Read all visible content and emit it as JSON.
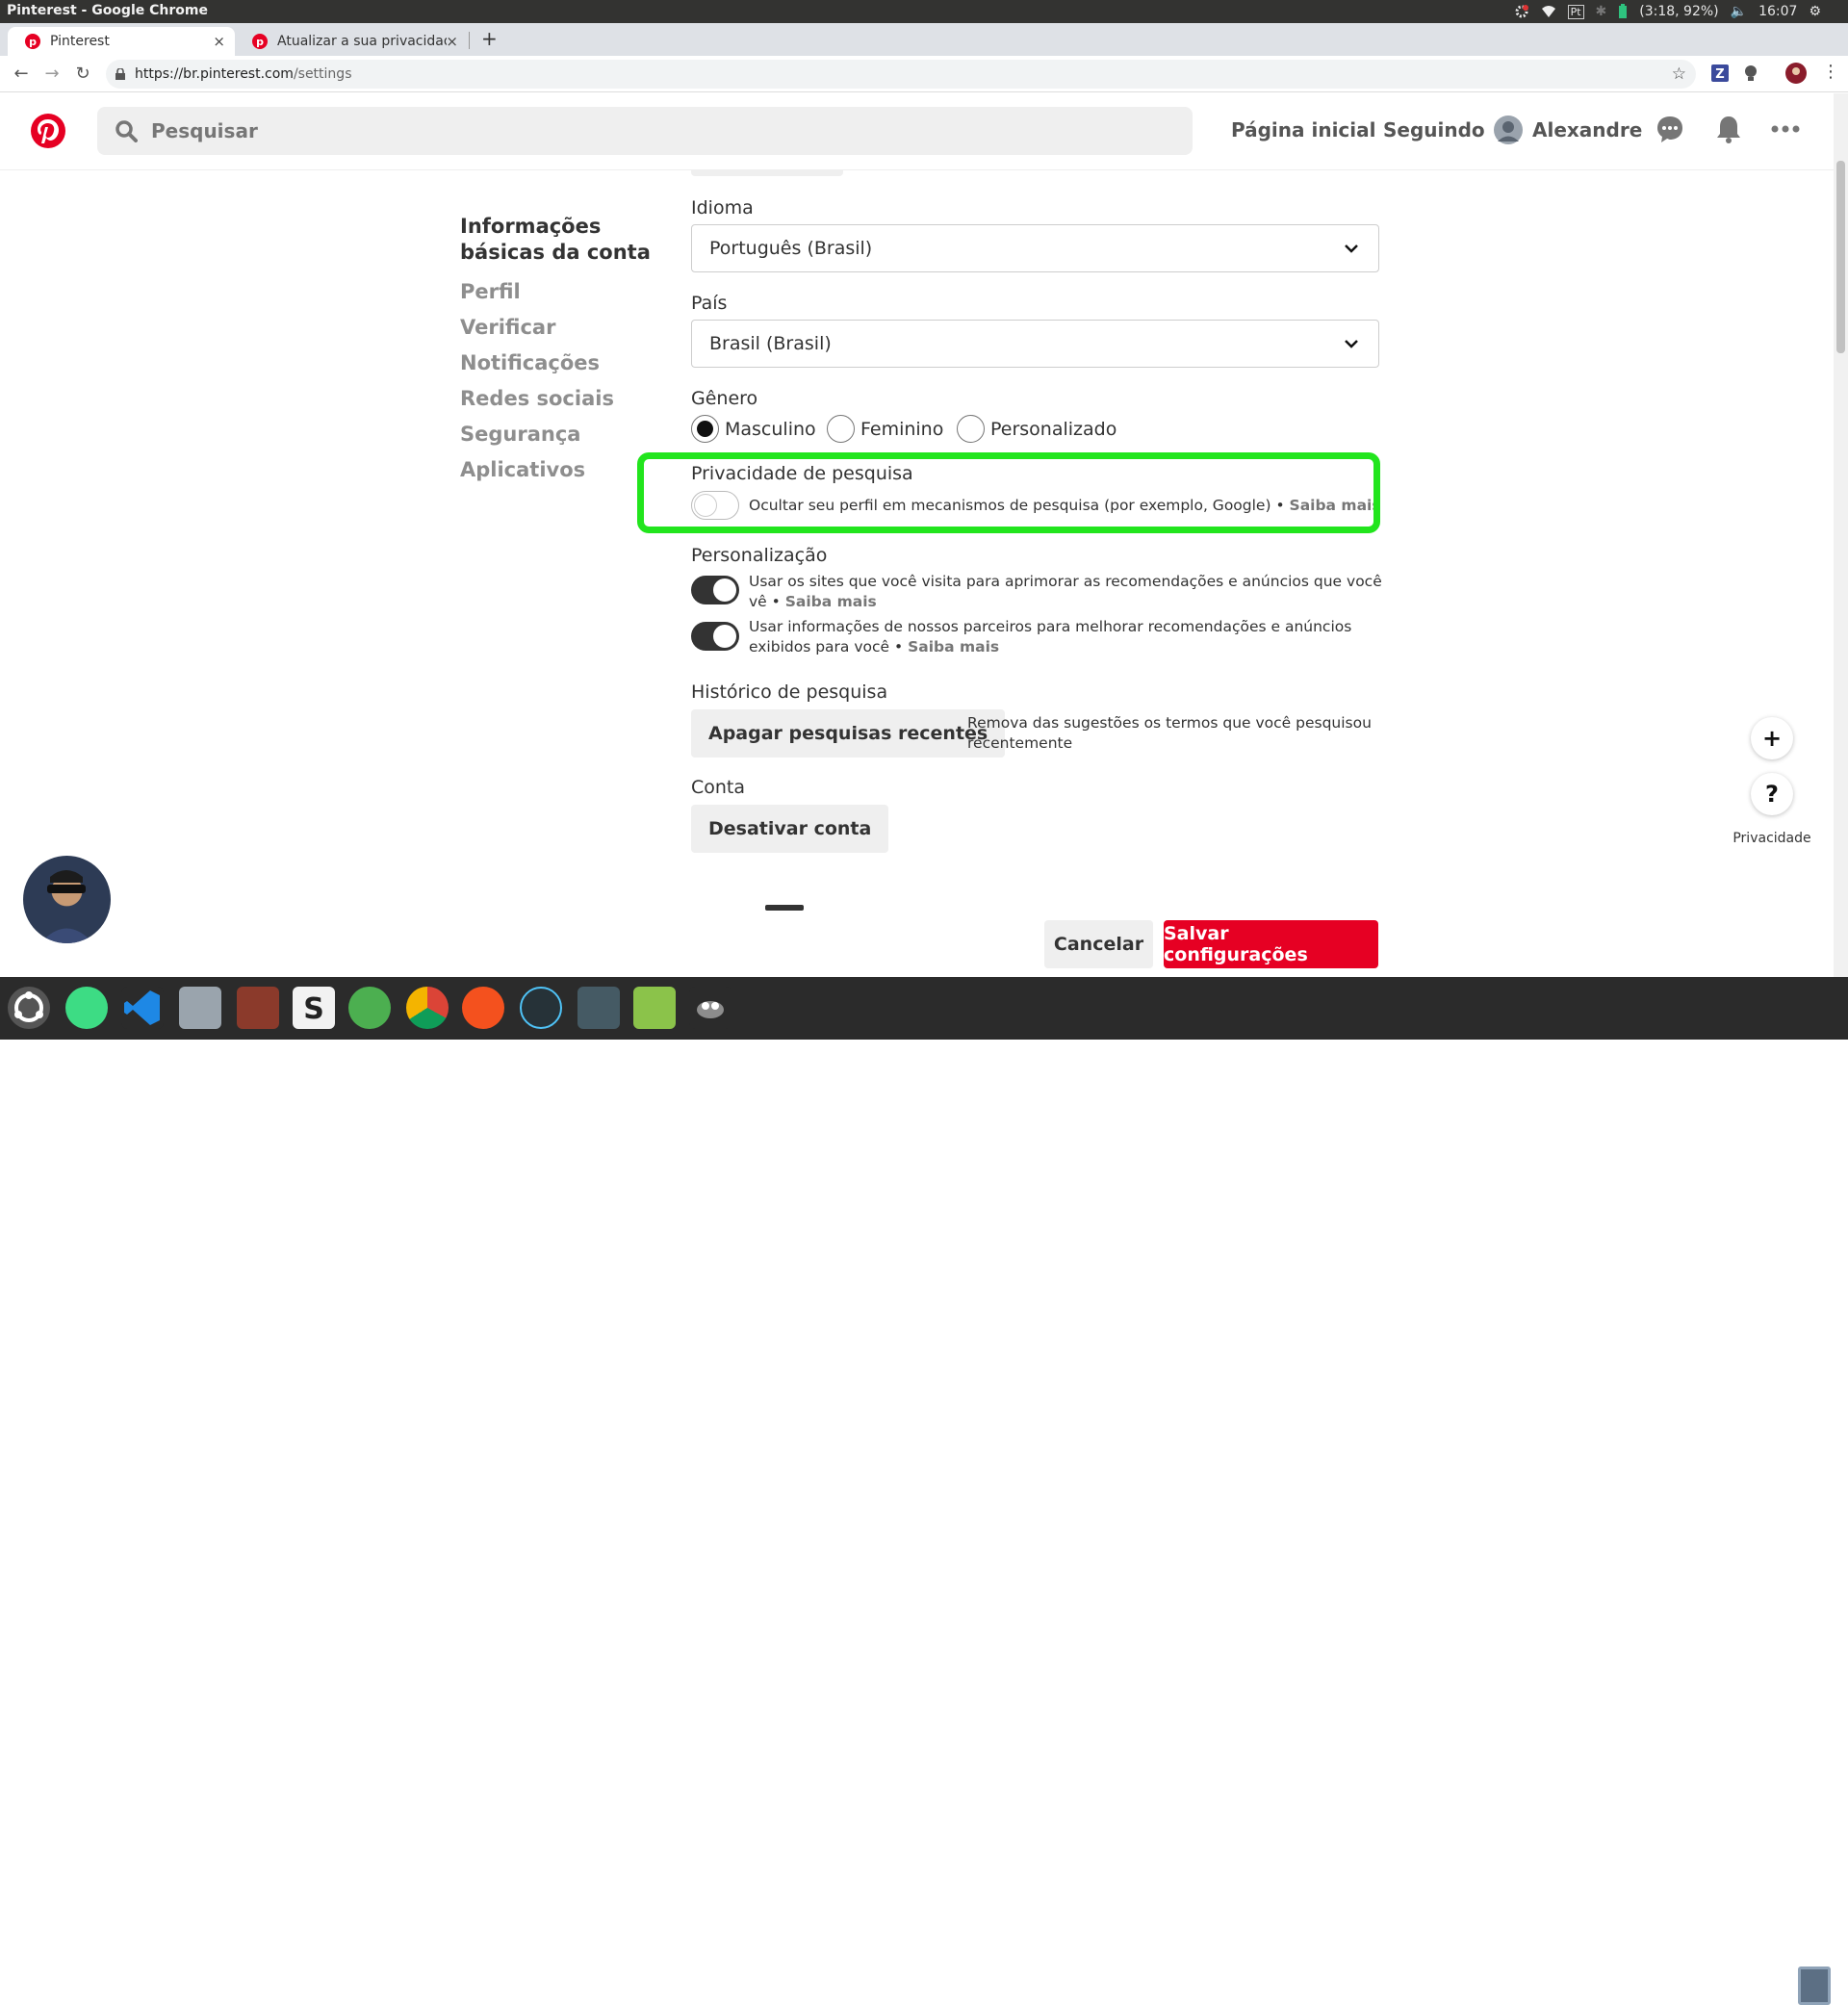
{
  "system_bar": {
    "window_title": "Pinterest - Google Chrome",
    "battery": "(3:18, 92%)",
    "clock": "16:07",
    "keyboard": "Pt"
  },
  "browser": {
    "tabs": [
      {
        "label": "Pinterest",
        "close": "×"
      },
      {
        "label": "Atualizar a sua privacidad",
        "close": "×"
      }
    ],
    "new_tab": "+",
    "url_host": "https://br.pinterest.com",
    "url_path": "/settings"
  },
  "header": {
    "search_placeholder": "Pesquisar",
    "nav_home": "Página inicial",
    "nav_following": "Seguindo",
    "user_name": "Alexandre"
  },
  "sidebar": {
    "items": [
      {
        "label": "Informações básicas da conta",
        "active": true
      },
      {
        "label": "Perfil"
      },
      {
        "label": "Verificar"
      },
      {
        "label": "Notificações"
      },
      {
        "label": "Redes sociais"
      },
      {
        "label": "Segurança"
      },
      {
        "label": "Aplicativos"
      }
    ]
  },
  "form": {
    "language": {
      "label": "Idioma",
      "value": "Português (Brasil)"
    },
    "country": {
      "label": "País",
      "value": "Brasil (Brasil)"
    },
    "gender": {
      "label": "Gênero",
      "options": [
        {
          "label": "Masculino",
          "selected": true
        },
        {
          "label": "Feminino",
          "selected": false
        },
        {
          "label": "Personalizado",
          "selected": false
        }
      ]
    },
    "search_privacy": {
      "label": "Privacidade de pesquisa",
      "text": "Ocultar seu perfil em mecanismos de pesquisa (por exemplo, Google) •",
      "link": "Saiba mais",
      "enabled": false
    },
    "personalization": {
      "label": "Personalização",
      "items": [
        {
          "text": "Usar os sites que você visita para aprimorar as recomendações e anúncios que você vê •",
          "link": "Saiba mais",
          "enabled": true
        },
        {
          "text": "Usar informações de nossos parceiros para melhorar recomendações e anúncios exibidos para você •",
          "link": "Saiba mais",
          "enabled": true
        }
      ]
    },
    "history": {
      "label": "Histórico de pesquisa",
      "button": "Apagar pesquisas recentes",
      "desc": "Remova das sugestões os termos que você pesquisou recentemente"
    },
    "account": {
      "label": "Conta",
      "button": "Desativar conta"
    }
  },
  "actions": {
    "cancel": "Cancelar",
    "save": "Salvar configurações"
  },
  "fab": {
    "plus": "+",
    "help": "?",
    "privacy_label": "Privacidade"
  },
  "colors": {
    "highlight": "#22e51d",
    "brand_red": "#e60023"
  }
}
